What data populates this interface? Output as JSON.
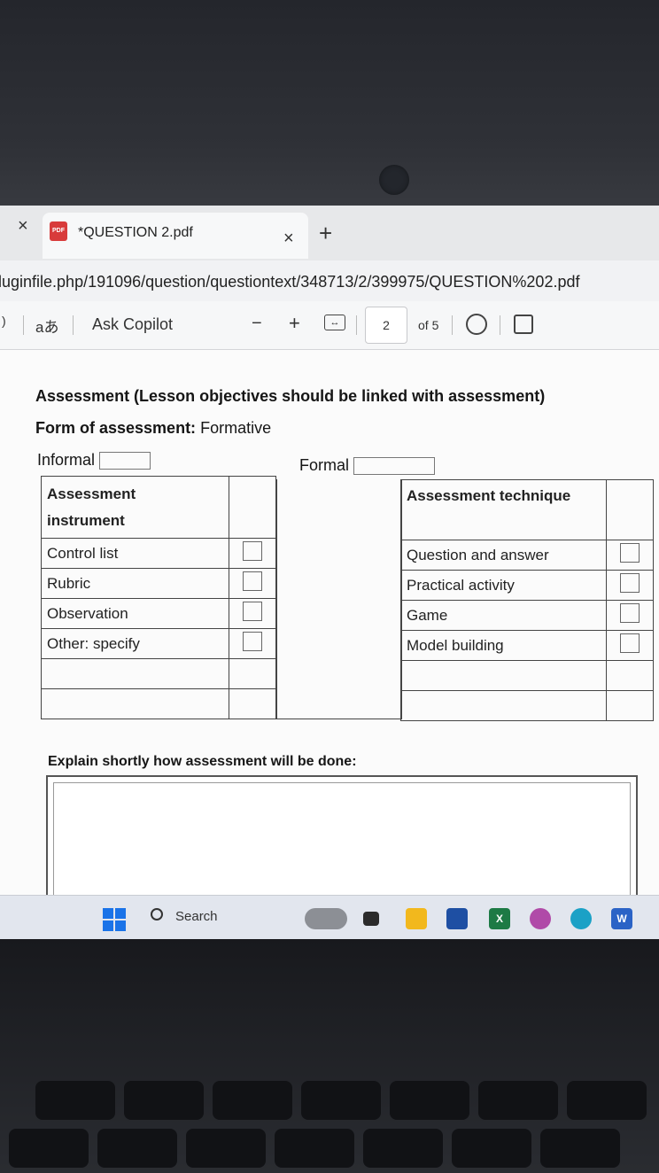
{
  "browser": {
    "tab_title": "*QUESTION 2.pdf",
    "pdf_badge": "PDF",
    "close_glyph": "×",
    "new_tab_glyph": "+",
    "url": "luginfile.php/191096/question/questiontext/348713/2/399975/QUESTION%202.pdf"
  },
  "toolbar": {
    "translate_label": "aあ",
    "copilot_label": "Ask Copilot",
    "zoom_out": "−",
    "zoom_in": "+",
    "fit_glyph": "↔",
    "page_current": "2",
    "page_total": "of 5"
  },
  "document": {
    "heading": "Assessment (Lesson objectives should be linked with assessment)",
    "form_label": "Form of assessment:",
    "form_value": "Formative",
    "informal_label": "Informal",
    "formal_label": "Formal",
    "left_table": {
      "header_line1": "Assessment",
      "header_line2": "instrument",
      "rows": [
        "Control list",
        "Rubric",
        "Observation",
        "Other: specify",
        "",
        ""
      ]
    },
    "right_table": {
      "header": "Assessment technique",
      "rows": [
        "Question and answer",
        "Practical activity",
        "Game",
        "Model building",
        "",
        ""
      ]
    },
    "explain_label": "Explain shortly how assessment will be done:"
  },
  "taskbar": {
    "search_label": "Search"
  },
  "colors": {
    "start_blue": "#1a73e8",
    "pdf_red": "#d83b3b"
  }
}
